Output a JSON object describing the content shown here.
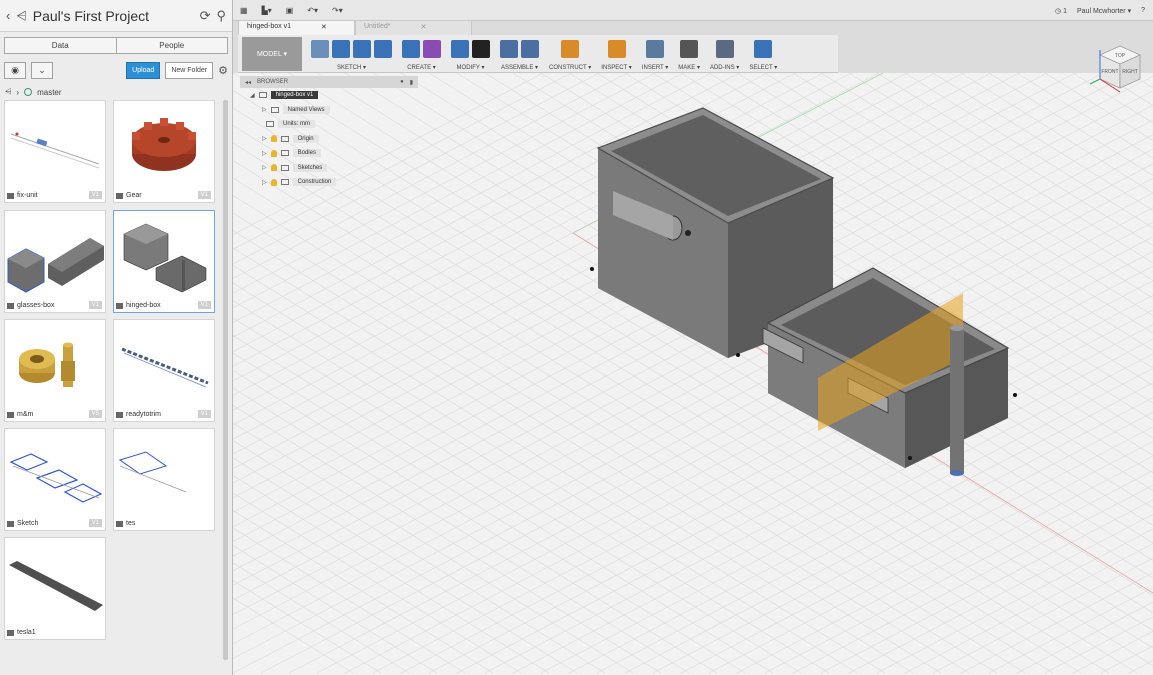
{
  "left_panel": {
    "project_title": "Paul's First Project",
    "tabs": [
      {
        "label": "Data",
        "active": true
      },
      {
        "label": "People",
        "active": false
      }
    ],
    "upload_label": "Upload",
    "new_folder_label": "New Folder",
    "branch": "master",
    "items": [
      {
        "name": "fix-unit",
        "version": "V1",
        "thumb": "fix-unit"
      },
      {
        "name": "Gear",
        "version": "V1",
        "thumb": "gear"
      },
      {
        "name": "glasses-box",
        "version": "V1",
        "thumb": "glasses-box"
      },
      {
        "name": "hinged-box",
        "version": "V1",
        "thumb": "hinged-box"
      },
      {
        "name": "m&m",
        "version": "V5",
        "thumb": "mm"
      },
      {
        "name": "readytotrim",
        "version": "V1",
        "thumb": "readytotrim"
      },
      {
        "name": "Sketch",
        "version": "V1",
        "thumb": "sketch"
      },
      {
        "name": "tes",
        "version": "",
        "thumb": "tes"
      },
      {
        "name": "tesla1",
        "version": "",
        "thumb": "tesla1"
      }
    ]
  },
  "topbar": {
    "tabs": [
      {
        "label": "hinged-box v1",
        "active": true
      },
      {
        "label": "Untitled*",
        "active": false
      }
    ],
    "jobs": "1",
    "user": "Paul Mcwhorter ▾",
    "help": "?"
  },
  "toolbar": {
    "workspace": "MODEL ▾",
    "groups": [
      {
        "label": "SKETCH ▾",
        "icons": [
          "#6a8fb8",
          "#3a72b8",
          "#3a72b8",
          "#3a72b8"
        ]
      },
      {
        "label": "CREATE ▾",
        "icons": [
          "#3a72b8",
          "#8a4bb5"
        ]
      },
      {
        "label": "MODIFY ▾",
        "icons": [
          "#3a72b8",
          "#222222"
        ]
      },
      {
        "label": "ASSEMBLE ▾",
        "icons": [
          "#4a6fa0",
          "#4a6fa0"
        ]
      },
      {
        "label": "CONSTRUCT ▾",
        "icons": [
          "#d98b2a"
        ]
      },
      {
        "label": "INSPECT ▾",
        "icons": [
          "#d98b2a"
        ]
      },
      {
        "label": "INSERT ▾",
        "icons": [
          "#5a7aa0"
        ]
      },
      {
        "label": "MAKE ▾",
        "icons": [
          "#555555"
        ]
      },
      {
        "label": "ADD-INS ▾",
        "icons": [
          "#5a6a80"
        ]
      },
      {
        "label": "SELECT ▾",
        "icons": [
          "#3a72b8"
        ]
      }
    ]
  },
  "browser": {
    "title": "BROWSER",
    "rows": [
      {
        "label": "hinged-box v1",
        "kind": "root"
      },
      {
        "label": "Named Views",
        "kind": "folder"
      },
      {
        "label": "Units: mm",
        "kind": "doc"
      },
      {
        "label": "Origin",
        "kind": "folder"
      },
      {
        "label": "Bodies",
        "kind": "folder"
      },
      {
        "label": "Sketches",
        "kind": "folder"
      },
      {
        "label": "Construction",
        "kind": "folder"
      }
    ]
  },
  "viewcube": {
    "front": "FRONT",
    "right": "RIGHT",
    "top": "TOP"
  },
  "colors": {
    "accent": "#2d8fd5",
    "plane": "#e8a21d",
    "body": "#8a8a8a"
  }
}
